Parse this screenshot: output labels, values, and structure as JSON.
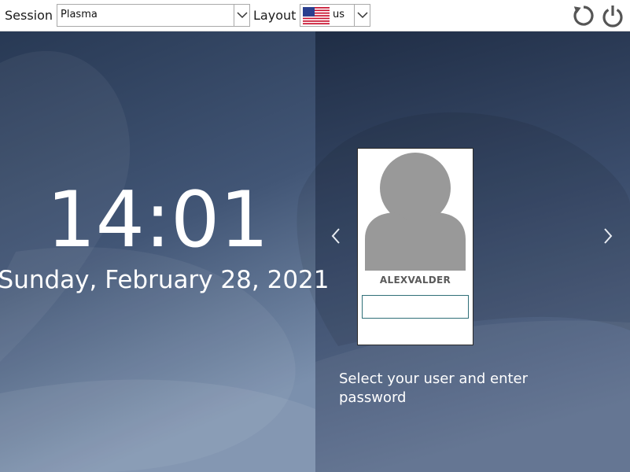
{
  "topbar": {
    "session_label": "Session",
    "session_value": "Plasma",
    "layout_label": "Layout",
    "layout_value": "us"
  },
  "clock": {
    "time": "14:01",
    "date": "Sunday, February 28, 2021"
  },
  "user": {
    "name": "ALEXVALDER",
    "password_value": ""
  },
  "hint": "Select your user and enter password",
  "colors": {
    "background": "#3a4b66",
    "topbar": "#ffffff",
    "card_border": "#2a2a2a",
    "password_border": "#2f6f78",
    "avatar": "#999999",
    "text": "#ffffff",
    "icon": "#555555"
  },
  "icons": {
    "reboot": "reboot-icon",
    "shutdown": "shutdown-icon",
    "prev": "chevron-left-icon",
    "next": "chevron-right-icon",
    "dropdown": "chevron-down-icon",
    "flag": "us-flag-icon"
  }
}
